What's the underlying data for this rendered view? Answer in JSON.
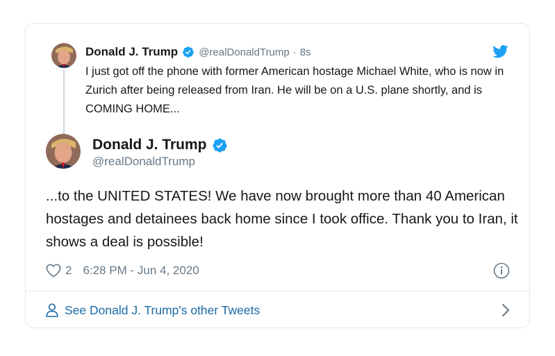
{
  "parent_tweet": {
    "author_name": "Donald J. Trump",
    "handle": "@realDonaldTrump",
    "separator": "·",
    "time_ago": "8s",
    "text": "I just got off the phone with former American hostage Michael White, who is now in Zurich after being released from Iran. He will be on a U.S. plane shortly, and is COMING HOME...",
    "avatar_icon": "avatar-portrait",
    "verified_icon": "verified-badge-icon"
  },
  "main_tweet": {
    "author_name": "Donald J. Trump",
    "handle": "@realDonaldTrump",
    "text": "...to the UNITED STATES! We have now brought more than 40 American hostages and detainees back home since I took office. Thank you to Iran, it shows a deal is possible!",
    "like_count": "2",
    "timestamp": "6:28 PM - Jun 4, 2020",
    "avatar_icon": "avatar-portrait",
    "verified_icon": "verified-badge-icon"
  },
  "footer": {
    "see_more_label": "See Donald J. Trump's other Tweets",
    "person_icon": "person-icon",
    "chevron_icon": "chevron-right-icon"
  },
  "icons": {
    "brand": "twitter-bird-icon",
    "like": "heart-icon",
    "info": "info-icon"
  },
  "colors": {
    "twitter_blue": "#1da1f2",
    "link_blue": "#1b6aa5",
    "secondary_text": "#657786",
    "primary_text": "#14171a",
    "border": "#e1e8ed"
  }
}
